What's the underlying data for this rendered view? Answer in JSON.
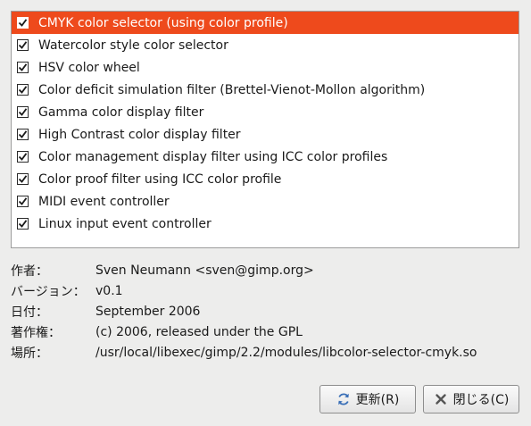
{
  "modules": [
    {
      "label": "CMYK color selector (using color profile)",
      "checked": true,
      "selected": true
    },
    {
      "label": "Watercolor style color selector",
      "checked": true,
      "selected": false
    },
    {
      "label": "HSV color wheel",
      "checked": true,
      "selected": false
    },
    {
      "label": "Color deficit simulation filter (Brettel-Vienot-Mollon algorithm)",
      "checked": true,
      "selected": false
    },
    {
      "label": "Gamma color display filter",
      "checked": true,
      "selected": false
    },
    {
      "label": "High Contrast color display filter",
      "checked": true,
      "selected": false
    },
    {
      "label": "Color management display filter using ICC color profiles",
      "checked": true,
      "selected": false
    },
    {
      "label": "Color proof filter using ICC color profile",
      "checked": true,
      "selected": false
    },
    {
      "label": "MIDI event controller",
      "checked": true,
      "selected": false
    },
    {
      "label": "Linux input event controller",
      "checked": true,
      "selected": false
    }
  ],
  "info": {
    "author": {
      "key": "作者：",
      "value": "Sven Neumann <sven@gimp.org>"
    },
    "version": {
      "key": "バージョン：",
      "value": "v0.1"
    },
    "date": {
      "key": "日付：",
      "value": "September 2006"
    },
    "copyright": {
      "key": "著作権：",
      "value": "(c) 2006, released under the GPL"
    },
    "location": {
      "key": "場所：",
      "value": "/usr/local/libexec/gimp/2.2/modules/libcolor-selector-cmyk.so"
    }
  },
  "buttons": {
    "refresh_label": "更新(R)",
    "close_label": "閉じる(C)"
  },
  "colors": {
    "selection": "#ee4a1c",
    "background": "#ededec"
  },
  "icons": {
    "refresh": "refresh-icon",
    "close": "close-icon",
    "checkbox": "checkmark-icon"
  }
}
